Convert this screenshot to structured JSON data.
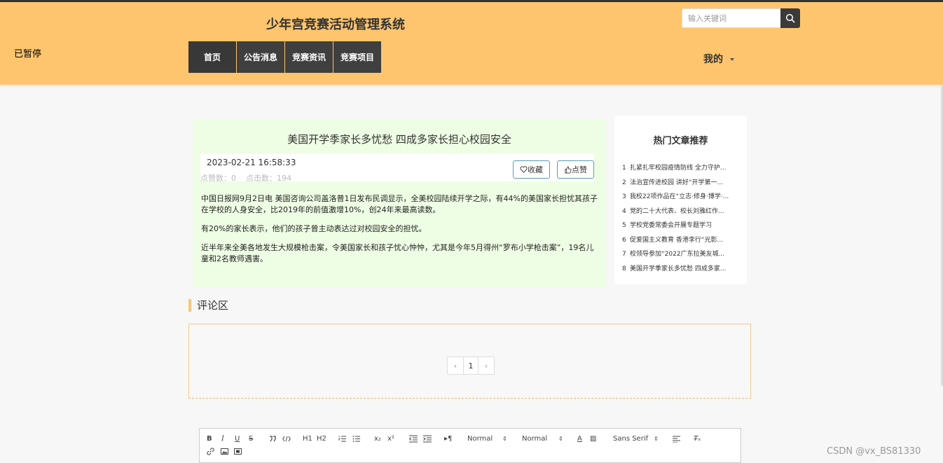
{
  "header": {
    "site_title": "少年宫竞赛活动管理系统",
    "paused_label": "已暂停",
    "search_placeholder": "输入关键词",
    "nav": [
      "首页",
      "公告消息",
      "竞赛资讯",
      "竞赛项目"
    ],
    "mine_label": "我的"
  },
  "article": {
    "title": "美国开学季家长多忧愁 四成多家长担心校园安全",
    "date": "2023-02-21 16:58:33",
    "likes_label": "点赞数：0",
    "clicks_label": "点击数：194",
    "favorite_label": "收藏",
    "like_label": "点赞",
    "paragraphs": [
      "中国日报网9月2日电 美国咨询公司盖洛普1日发布民调显示，全美校园陆续开学之际，有44%的美国家长担忧其孩子在学校的人身安全，比2019年的前值激增10%，创24年来最高读数。",
      "有20%的家长表示，他们的孩子曾主动表达过对校园安全的担忧。",
      "近半年来全美各地发生大规模枪击案，令美国家长和孩子忧心忡忡，尤其是今年5月得州“罗布小学枪击案”，19名儿童和2名教师遇害。"
    ]
  },
  "hot": {
    "title": "热门文章推荐",
    "items": [
      {
        "num": "1",
        "text": "扎紧扎牢校园疫情防线 全力守护..."
      },
      {
        "num": "2",
        "text": "法治宣传进校园 讲好“开学第一..."
      },
      {
        "num": "3",
        "text": "我校22项作品在“立志·修身·博学·..."
      },
      {
        "num": "4",
        "text": "党的二十大代表、校长刘雅红作..."
      },
      {
        "num": "5",
        "text": "学校党委常委会开展专题学习"
      },
      {
        "num": "6",
        "text": "促爱国主义教育 香港李行“光影..."
      },
      {
        "num": "7",
        "text": "校领导参加“2022广东拉美友城..."
      },
      {
        "num": "8",
        "text": "美国开学季家长多忧愁 四成多家..."
      }
    ]
  },
  "comments": {
    "title": "评论区",
    "page_prev": "‹",
    "page_current": "1",
    "page_next": "›"
  },
  "editor": {
    "header_h1": "H1",
    "header_h2": "H2",
    "sub": "x₂",
    "sup": "x²",
    "size_1": "Normal",
    "size_2": "Normal",
    "font": "Sans Serif"
  },
  "watermark": "CSDN @vx_BS81330",
  "colors": {
    "header_bg": "#ffc56e",
    "nav_bg": "#3f3f3f",
    "article_bg": "#eefee4",
    "button_border": "#5b9ab0"
  }
}
